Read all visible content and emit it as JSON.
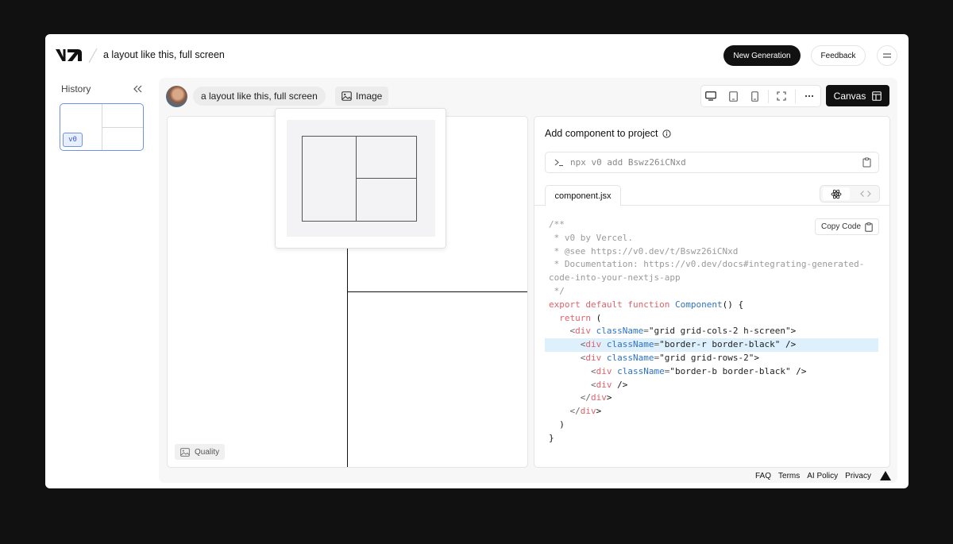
{
  "header": {
    "brand": "v0",
    "project_title": "a layout like this, full screen",
    "new_generation_label": "New Generation",
    "feedback_label": "Feedback",
    "menu_icon": "hamburger-icon"
  },
  "sidebar": {
    "history_label": "History",
    "collapse_icon": "double-chevron-left-icon",
    "items": [
      {
        "badge": "v0",
        "selected": true
      }
    ]
  },
  "chat": {
    "prompt": "a layout like this, full screen",
    "attachment_label": "Image"
  },
  "toolbar": {
    "devices": [
      "desktop-icon",
      "tablet-icon",
      "mobile-icon"
    ],
    "fullscreen_icon": "fullscreen-icon",
    "more_icon": "more-horizontal-icon",
    "canvas_label": "Canvas"
  },
  "preview": {
    "quality_label": "Quality"
  },
  "code_panel": {
    "add_title": "Add component to project",
    "command": "npx v0 add Bswz26iCNxd",
    "file_tab": "component.jsx",
    "copy_label": "Copy Code",
    "code_lines": [
      "/**",
      " * v0 by Vercel.",
      " * @see https://v0.dev/t/Bswz26iCNxd",
      " * Documentation: https://v0.dev/docs#integrating-generated-",
      "code-into-your-nextjs-app",
      " */",
      "export default function Component() {",
      "  return (",
      "    <div className=\"grid grid-cols-2 h-screen\">",
      "      <div className=\"border-r border-black\" />",
      "      <div className=\"grid grid-rows-2\">",
      "        <div className=\"border-b border-black\" />",
      "        <div />",
      "      </div>",
      "    </div>",
      "  )",
      "}"
    ],
    "highlighted_line": 9
  },
  "footer": {
    "links": [
      "FAQ",
      "Terms",
      "AI Policy",
      "Privacy"
    ]
  },
  "colors": {
    "background": "#111111",
    "accent": "#111111",
    "highlight": "#ddf0fb",
    "keyword": "#e0626a",
    "function": "#2e72c9"
  }
}
